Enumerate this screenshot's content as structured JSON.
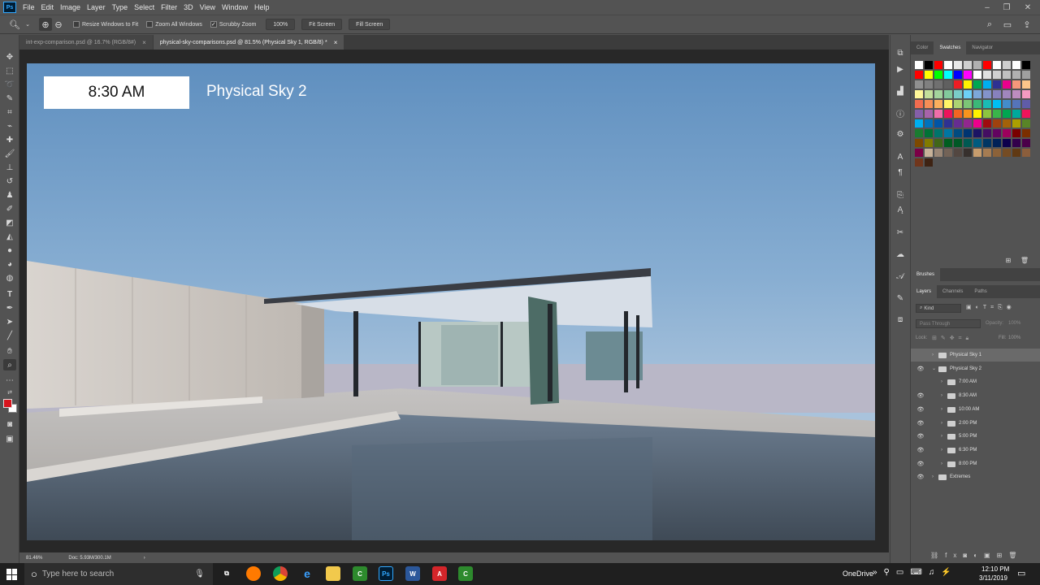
{
  "menubar": {
    "logo": "Ps",
    "items": [
      "File",
      "Edit",
      "Image",
      "Layer",
      "Type",
      "Select",
      "Filter",
      "3D",
      "View",
      "Window",
      "Help"
    ]
  },
  "options": {
    "resize_windows": "Resize Windows to Fit",
    "zoom_all": "Zoom All Windows",
    "scrubby_zoom": "Scrubby Zoom",
    "zoom_value": "100%",
    "fit_screen": "Fit Screen",
    "fill_screen": "Fill Screen"
  },
  "tabs": [
    {
      "label": "int-exp-comparison.psd @ 16.7% (RGB/8#)",
      "close": "×"
    },
    {
      "label": "physical-sky-comparisons.psd @ 81.5% (Physical Sky 1, RGB/8) *",
      "close": "×"
    }
  ],
  "canvas": {
    "time_label": "8:30 AM",
    "sky_title": "Physical Sky 2"
  },
  "status": {
    "zoom": "81.46%",
    "doc": "Doc: 5.93M/300.1M"
  },
  "panels": {
    "top_tabs": [
      "Color",
      "Swatches",
      "Navigator"
    ],
    "brushes_tab": "Brushes",
    "layer_tabs": [
      "Layers",
      "Channels",
      "Paths"
    ],
    "kind_label": "Kind",
    "blend_mode": "Pass Through",
    "opacity_label": "Opacity:",
    "opacity_value": "100%",
    "lock_label": "Lock:",
    "fill_label": "Fill:",
    "fill_value": "100%"
  },
  "layers": [
    {
      "name": "Physical Sky 1",
      "visible": false,
      "indent": 0,
      "expanded": false,
      "selected": true
    },
    {
      "name": "Physical Sky 2",
      "visible": true,
      "indent": 0,
      "expanded": true,
      "selected": false
    },
    {
      "name": "7:00 AM",
      "visible": false,
      "indent": 1,
      "expanded": false,
      "selected": false
    },
    {
      "name": "8:30 AM",
      "visible": true,
      "indent": 1,
      "expanded": false,
      "selected": false
    },
    {
      "name": "10:00 AM",
      "visible": true,
      "indent": 1,
      "expanded": false,
      "selected": false
    },
    {
      "name": "2:00 PM",
      "visible": true,
      "indent": 1,
      "expanded": false,
      "selected": false
    },
    {
      "name": "5:00 PM",
      "visible": true,
      "indent": 1,
      "expanded": false,
      "selected": false
    },
    {
      "name": "6:30 PM",
      "visible": true,
      "indent": 1,
      "expanded": false,
      "selected": false
    },
    {
      "name": "8:00 PM",
      "visible": true,
      "indent": 1,
      "expanded": false,
      "selected": false
    },
    {
      "name": "Extremes",
      "visible": true,
      "indent": 0,
      "expanded": false,
      "selected": false
    }
  ],
  "swatch_colors": [
    [
      "#ffffff",
      "#000000",
      "#ff0000",
      "#ffffff",
      "#e8e8e8",
      "#d0d0d0",
      "#b0b0b0",
      "#ff0000",
      "#ffffff",
      "#d0d0d0",
      "#ffffff",
      "#000000"
    ],
    [
      "#ff0000",
      "#ffff00",
      "#00ff00",
      "#00ffff",
      "#0000ff",
      "#ff00ff",
      "#ffffff",
      "#e0e0e0",
      "#d0d0d0",
      "#c0c0c0",
      "#b0b0b0",
      "#a0a0a0"
    ],
    [
      "#909090",
      "#808080",
      "#707070",
      "#606060",
      "#ed1c24",
      "#fff200",
      "#00a651",
      "#00aeef",
      "#2e3192",
      "#ec008c",
      "#f7977a",
      "#fdc68a"
    ],
    [
      "#fff799",
      "#c4df9b",
      "#a3d39c",
      "#82ca9c",
      "#7accc8",
      "#6dcff6",
      "#7da7d9",
      "#8393ca",
      "#8781bd",
      "#a186be",
      "#bd8cbf",
      "#f49ac1"
    ],
    [
      "#f26c4f",
      "#f68e56",
      "#fbaf5d",
      "#fff467",
      "#acd372",
      "#7cc576",
      "#3bb878",
      "#1abbb4",
      "#00bff3",
      "#438ccb",
      "#5574b9",
      "#605ca8"
    ],
    [
      "#855fa8",
      "#a763a9",
      "#f06ea9",
      "#ed145b",
      "#f26522",
      "#f7941d",
      "#fff200",
      "#8dc63f",
      "#39b54a",
      "#00a651",
      "#00a99d",
      "#ed145b"
    ],
    [
      "#00aeef",
      "#0072bc",
      "#0054a6",
      "#2e3192",
      "#662d91",
      "#92278f",
      "#ec008c",
      "#9e0b0f",
      "#a0410d",
      "#a3620a",
      "#aba000",
      "#598527"
    ],
    [
      "#1a7b30",
      "#007236",
      "#00746b",
      "#0076a3",
      "#004b80",
      "#003471",
      "#1b1464",
      "#440e62",
      "#630460",
      "#9e005d",
      "#790000",
      "#7b2e00"
    ],
    [
      "#7d4900",
      "#827b00",
      "#406618",
      "#005e20",
      "#005826",
      "#005952",
      "#005b7f",
      "#003663",
      "#002157",
      "#0d004c",
      "#32004b",
      "#4b0049"
    ],
    [
      "#7b0046",
      "#c7b299",
      "#998675",
      "#736357",
      "#534741",
      "#37302d",
      "#c69c6d",
      "#a67c52",
      "#8c6239",
      "#754c24",
      "#603913",
      "#8b5e3c"
    ],
    [
      "#70361c",
      "#3e2313"
    ]
  ],
  "taskbar": {
    "search_placeholder": "Type here to search",
    "onedrive": "OneDrive",
    "time": "12:10 PM",
    "date": "3/11/2019"
  }
}
